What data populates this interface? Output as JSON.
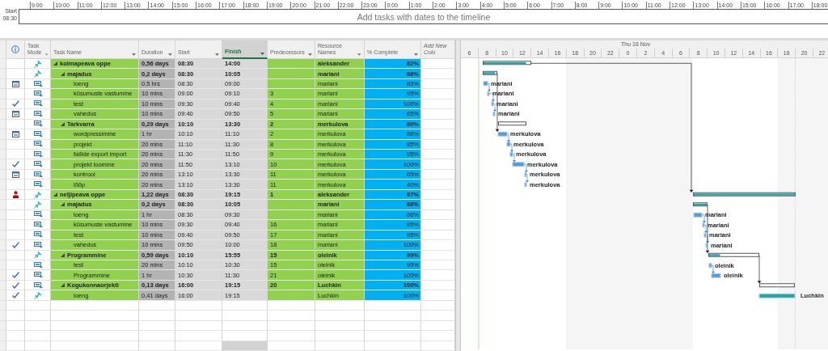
{
  "timeline": {
    "start_label": "Start",
    "start_time": "08:30",
    "ticks": [
      "9:00",
      "10:00",
      "11:00",
      "12:00",
      "13:00",
      "14:00",
      "15:00",
      "16:00",
      "17:00",
      "18:00",
      "19:00",
      "20:00",
      "21:00",
      "22:00",
      "23:00",
      "0:00",
      "1:00",
      "2:00",
      "3:00",
      "4:00",
      "5:00",
      "6:00",
      "7:00",
      "8:00",
      "9:00",
      "10:00",
      "11:00",
      "12:00",
      "13:00",
      "14:00",
      "15:00",
      "16:00",
      "17:00",
      "18:00"
    ],
    "placeholder": "Add tasks with dates to the timeline"
  },
  "table": {
    "columns": [
      {
        "kind": "field",
        "label": "Task Mode",
        "selected": false
      },
      {
        "kind": "field",
        "label": "Task Name",
        "selected": false
      },
      {
        "kind": "field",
        "label": "Duration",
        "selected": false
      },
      {
        "kind": "field",
        "label": "Start",
        "selected": false
      },
      {
        "kind": "field",
        "label": "Finish",
        "selected": true
      },
      {
        "kind": "field",
        "label": "Predecessors",
        "selected": false
      },
      {
        "kind": "field",
        "label": "Resource Names",
        "selected": false
      },
      {
        "kind": "field",
        "label": "% Complete",
        "selected": false
      },
      {
        "kind": "add",
        "label": "Add New Colu",
        "selected": false
      }
    ],
    "tasks": [
      {
        "name": "kolmapeava oppe",
        "manual": true,
        "expanded": true,
        "duration": "0,56 days",
        "start": "08:30",
        "finish": "14:00",
        "resource": "aleksander",
        "complete": "82%",
        "children": [
          {
            "name": "majadus",
            "manual": true,
            "expanded": true,
            "duration": "0,2 days",
            "start": "08:30",
            "finish": "10:05",
            "resource": "mariani",
            "complete": "86%",
            "children": [
              {
                "name": "loeng",
                "indicator": {
                  "kind": "calendar"
                },
                "manual": false,
                "duration": "0,5 hrs",
                "start": "08:30",
                "finish": "09:00",
                "resource": "mariani",
                "complete": "85%"
              },
              {
                "name": "küsumuste vastumine",
                "manual": false,
                "duration": "10 mins",
                "start": "09:00",
                "finish": "09:10",
                "predecessors": "3",
                "resource": "mariani",
                "complete": "95%"
              },
              {
                "name": "test",
                "indicator": {
                  "kind": "check"
                },
                "manual": false,
                "duration": "10 mins",
                "start": "09:30",
                "finish": "09:40",
                "predecessors": "4",
                "resource": "mariani",
                "complete": "100%"
              },
              {
                "name": "vahedus",
                "indicator": {
                  "kind": "calendar"
                },
                "manual": false,
                "duration": "10 mins",
                "start": "09:40",
                "finish": "09:50",
                "predecessors": "5",
                "resource": "mariani",
                "complete": "65%"
              }
            ]
          },
          {
            "name": "Tarkvarra",
            "manual": false,
            "expanded": true,
            "duration": "0,29 days",
            "start": "10:10",
            "finish": "13:30",
            "predecessors": "2",
            "resource": "merkulova",
            "complete": "80%",
            "children": [
              {
                "name": "wordpressimine",
                "indicator": {
                  "kind": "calendar"
                },
                "manual": false,
                "duration": "1 hr",
                "start": "10:10",
                "finish": "11:10",
                "predecessors": "2",
                "resource": "merkulova",
                "complete": "86%"
              },
              {
                "name": "projekt",
                "manual": false,
                "duration": "20 mins",
                "start": "11:10",
                "finish": "11:30",
                "predecessors": "8",
                "resource": "merkulova",
                "complete": "85%"
              },
              {
                "name": "failide export import",
                "manual": false,
                "duration": "20 mins",
                "start": "11:30",
                "finish": "11:50",
                "predecessors": "9",
                "resource": "merkulova",
                "complete": "95%"
              },
              {
                "name": "projekt loomine",
                "indicator": {
                  "kind": "check"
                },
                "manual": false,
                "duration": "20 mins",
                "start": "11:50",
                "finish": "13:10",
                "predecessors": "10",
                "resource": "merkulova",
                "complete": "100%"
              },
              {
                "name": "kontrool",
                "indicator": {
                  "kind": "calendar"
                },
                "manual": false,
                "duration": "20 mins",
                "start": "13:10",
                "finish": "13:30",
                "predecessors": "11",
                "resource": "merkulova",
                "complete": "65%"
              },
              {
                "name": "lõõp",
                "manual": false,
                "duration": "20 mins",
                "start": "13:10",
                "finish": "13:30",
                "predecessors": "11",
                "resource": "merkulova",
                "complete": "40%"
              }
            ]
          }
        ]
      },
      {
        "name": "neljipeava oppe",
        "indicator": {
          "kind": "person"
        },
        "manual": true,
        "expanded": true,
        "duration": "1,22 days",
        "start": "08:30",
        "finish": "19:15",
        "predecessors": "1",
        "resource": "aleksander",
        "complete": "97%",
        "children": [
          {
            "name": "majadus",
            "manual": true,
            "expanded": true,
            "duration": "0,2 days",
            "start": "08:30",
            "finish": "10:05",
            "resource": "mariani",
            "complete": "88%",
            "children": [
              {
                "name": "loeng",
                "manual": false,
                "duration": "1 hr",
                "start": "08:30",
                "finish": "09:30",
                "resource": "mariani",
                "complete": "86%"
              },
              {
                "name": "küsumuste vastumine",
                "manual": false,
                "duration": "10 mins",
                "start": "09:30",
                "finish": "09:40",
                "predecessors": "16",
                "resource": "mariani",
                "complete": "85%"
              },
              {
                "name": "test",
                "manual": false,
                "duration": "10 mins",
                "start": "09:40",
                "finish": "09:50",
                "predecessors": "17",
                "resource": "mariani",
                "complete": "95%"
              },
              {
                "name": "vahedus",
                "indicator": {
                  "kind": "check"
                },
                "manual": false,
                "duration": "10 mins",
                "start": "09:50",
                "finish": "10:00",
                "predecessors": "18",
                "resource": "mariani",
                "complete": "100%"
              }
            ]
          },
          {
            "name": "Programmine",
            "manual": true,
            "expanded": true,
            "duration": "0,59 days",
            "start": "10:10",
            "finish": "15:55",
            "predecessors": "15",
            "resource": "oleinik",
            "complete": "99%",
            "children": [
              {
                "name": "test",
                "manual": false,
                "duration": "20 mins",
                "start": "10:10",
                "finish": "10:30",
                "predecessors": "15",
                "resource": "oleinik",
                "complete": "95%"
              },
              {
                "name": "Programmine",
                "indicator": {
                  "kind": "check"
                },
                "manual": false,
                "duration": "1 hr",
                "start": "10:30",
                "finish": "11:30",
                "predecessors": "21",
                "resource": "oleinik",
                "complete": "100%"
              }
            ]
          },
          {
            "name": "Kogukonnaorjekti",
            "indicator": {
              "kind": "check"
            },
            "manual": false,
            "expanded": true,
            "duration": "0,13 days",
            "start": "16:00",
            "finish": "19:15",
            "predecessors": "20",
            "resource": "Luchkin",
            "complete": "100%",
            "children": [
              {
                "name": "loeng",
                "indicator": {
                  "kind": "check"
                },
                "manual": true,
                "duration": "0,41 days",
                "start": "16:00",
                "finish": "19:15",
                "resource": "Luchkin",
                "complete": "100%"
              }
            ]
          }
        ]
      }
    ]
  },
  "gantt": {
    "day_label": "Thu 16 Nov",
    "hours": [
      "6",
      "8",
      "10",
      "12",
      "14",
      "16",
      "18",
      "20",
      "22",
      "0",
      "2",
      "4",
      "6",
      "8",
      "10",
      "12",
      "14",
      "16",
      "18",
      "20",
      "22"
    ],
    "bars": [
      {
        "kind": "summary"
      },
      {
        "kind": "summary"
      },
      {
        "kind": "task",
        "label": "mariani"
      },
      {
        "kind": "task",
        "label": "mariani"
      },
      {
        "kind": "task",
        "label": "mariani"
      },
      {
        "kind": "task",
        "label": "mariani"
      },
      {
        "kind": "summary"
      },
      {
        "kind": "task",
        "label": "merkulova"
      },
      {
        "kind": "task",
        "label": "merkulova"
      },
      {
        "kind": "task",
        "label": "merkulova"
      },
      {
        "kind": "task",
        "label": "merkulova"
      },
      {
        "kind": "task",
        "label": "merkulova"
      },
      {
        "kind": "task",
        "label": "merkulova"
      },
      {
        "kind": "summary"
      },
      {
        "kind": "summary"
      },
      {
        "kind": "task",
        "label": "mariani"
      },
      {
        "kind": "task",
        "label": "mariani"
      },
      {
        "kind": "task",
        "label": "mariani"
      },
      {
        "kind": "task",
        "label": "mariani"
      },
      {
        "kind": "summary"
      },
      {
        "kind": "task",
        "label": "oleinik"
      },
      {
        "kind": "task",
        "label": "oleinik"
      },
      {
        "kind": "summary"
      },
      {
        "kind": "manual",
        "label": "Luchkin"
      }
    ]
  }
}
